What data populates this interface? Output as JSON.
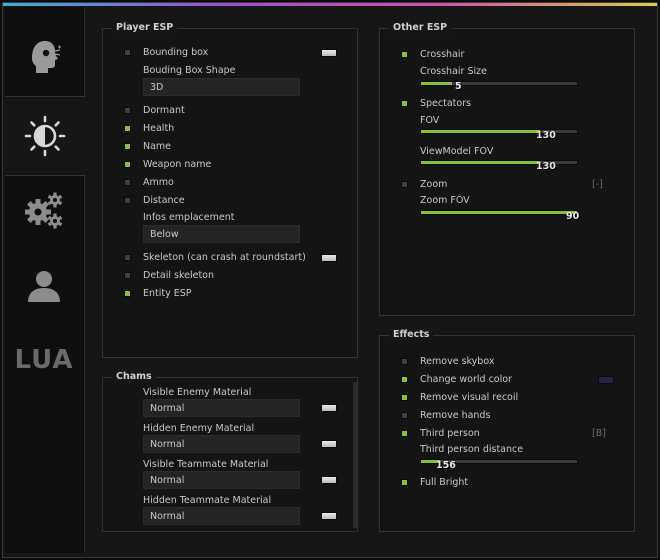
{
  "sidebar": {
    "tabs": [
      {
        "icon": "aimbot-head-icon"
      },
      {
        "icon": "visuals-sun-icon",
        "active": true
      },
      {
        "icon": "gears-icon"
      },
      {
        "icon": "user-icon"
      },
      {
        "label": "LUA"
      }
    ]
  },
  "player_esp": {
    "title": "Player ESP",
    "bounding_box": {
      "label": "Bounding box",
      "checked": false
    },
    "box_shape": {
      "label": "Bouding Box Shape",
      "value": "3D"
    },
    "dormant": {
      "label": "Dormant",
      "checked": false
    },
    "health": {
      "label": "Health",
      "checked": true
    },
    "name": {
      "label": "Name",
      "checked": true
    },
    "weapon_name": {
      "label": "Weapon name",
      "checked": true
    },
    "ammo": {
      "label": "Ammo",
      "checked": false
    },
    "distance": {
      "label": "Distance",
      "checked": false
    },
    "infos_emplacement": {
      "label": "Infos emplacement",
      "value": "Below"
    },
    "skeleton": {
      "label": "Skeleton (can crash at roundstart)",
      "checked": false
    },
    "detail_skeleton": {
      "label": "Detail skeleton",
      "checked": false
    },
    "entity_esp": {
      "label": "Entity ESP",
      "checked": true
    }
  },
  "chams": {
    "title": "Chams",
    "items": [
      {
        "label": "Visible Enemy Material",
        "value": "Normal"
      },
      {
        "label": "Hidden Enemy Material",
        "value": "Normal"
      },
      {
        "label": "Visible Teammate Material",
        "value": "Normal"
      },
      {
        "label": "Hidden Teammate Material",
        "value": "Normal"
      }
    ]
  },
  "other_esp": {
    "title": "Other ESP",
    "crosshair": {
      "label": "Crosshair",
      "checked": true
    },
    "crosshair_size": {
      "label": "Crosshair Size",
      "value": "5",
      "fraction": 0.2
    },
    "spectators": {
      "label": "Spectators",
      "checked": true
    },
    "fov": {
      "label": "FOV",
      "value": "130",
      "fraction": 0.76
    },
    "viewmodel_fov": {
      "label": "ViewModel FOV",
      "value": "130",
      "fraction": 0.76
    },
    "zoom": {
      "label": "Zoom",
      "checked": false,
      "keybind": "[-]"
    },
    "zoom_fov": {
      "label": "Zoom FOV",
      "value": "90",
      "fraction": 1.0
    }
  },
  "effects": {
    "title": "Effects",
    "remove_skybox": {
      "label": "Remove skybox",
      "checked": false
    },
    "change_world_color": {
      "label": "Change world color",
      "checked": true
    },
    "remove_visual_recoil": {
      "label": "Remove visual recoil",
      "checked": true
    },
    "remove_hands": {
      "label": "Remove hands",
      "checked": false
    },
    "third_person": {
      "label": "Third person",
      "checked": true,
      "keybind": "[B]"
    },
    "third_person_distance": {
      "label": "Third person distance",
      "value": "156",
      "fraction": 0.12
    },
    "full_bright": {
      "label": "Full Bright",
      "checked": true
    }
  },
  "colors": {
    "accent": "#8ac13b",
    "unchecked": "#404040",
    "panel": "#141414",
    "background": "#161616"
  }
}
